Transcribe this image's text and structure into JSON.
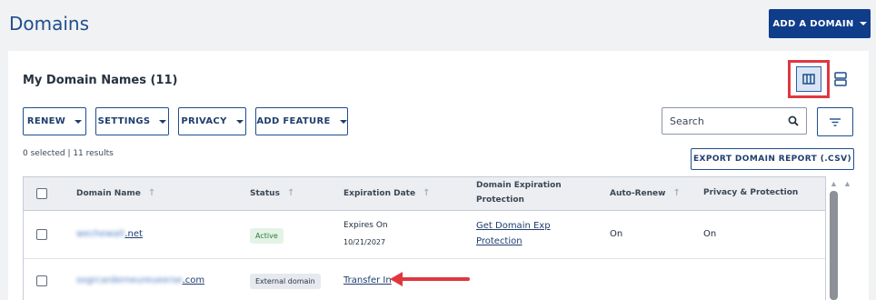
{
  "header": {
    "title": "Domains",
    "add_domain_label": "ADD A DOMAIN"
  },
  "card": {
    "title": "My Domain Names (11)",
    "toolbar": {
      "renew": "RENEW",
      "settings": "SETTINGS",
      "privacy": "PRIVACY",
      "add_feature": "ADD FEATURE",
      "search_placeholder": "Search"
    },
    "selection_text": "0 selected | 11 results",
    "export_label": "EXPORT DOMAIN REPORT (.CSV)"
  },
  "table": {
    "columns": {
      "domain_name": "Domain Name",
      "status": "Status",
      "expiration_date": "Expiration Date",
      "domain_exp_protection_1": "Domain Expiration",
      "domain_exp_protection_2": "Protection",
      "auto_renew": "Auto-Renew",
      "privacy": "Privacy & Protection"
    },
    "rows": [
      {
        "domain_blurred": "wechewait",
        "domain_tld": ".net",
        "status": "Active",
        "expires_label": "Expires On",
        "expires_date": "10/21/2027",
        "protection_1": "Get Domain Exp",
        "protection_2": "Protection",
        "auto_renew": "On",
        "privacy": "On"
      },
      {
        "domain_blurred": "sogrcarderneureueerse",
        "domain_tld": ".com",
        "status": "External domain",
        "transfer_label": "Transfer In"
      }
    ]
  },
  "colors": {
    "brand": "#0f3d8a",
    "link": "#1f3e6e",
    "active_badge_bg": "#e3f3e6",
    "active_badge_fg": "#2f7a3e",
    "external_badge_bg": "#e6e9ee",
    "highlight": "#e0373f",
    "arrow": "#e0373f"
  },
  "icons": [
    "column-view-icon",
    "row-view-icon",
    "search-icon",
    "filter-icon",
    "sort-arrow-icon",
    "dropdown-caret-icon",
    "annotation-arrow"
  ]
}
